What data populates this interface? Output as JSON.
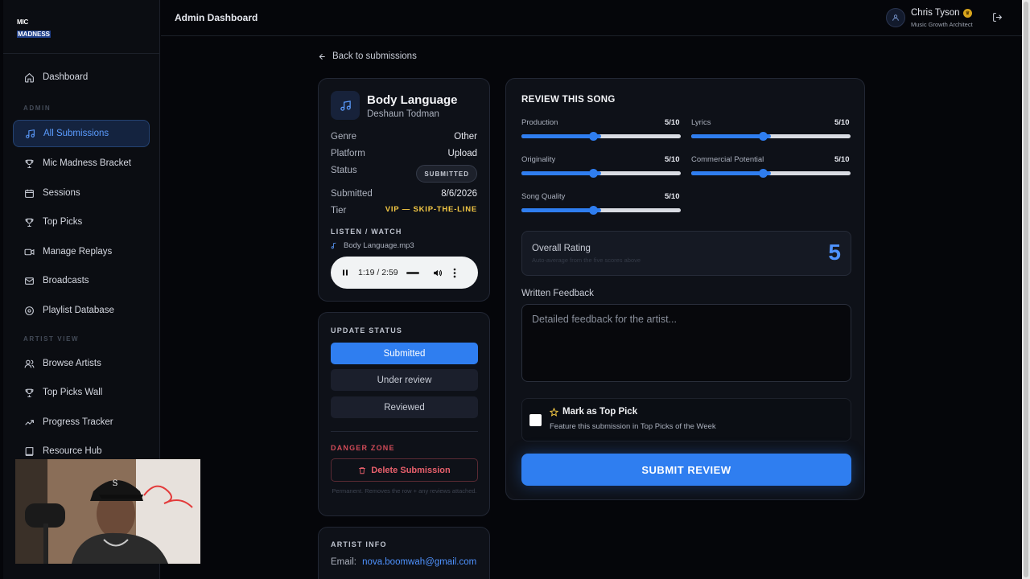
{
  "app": {
    "logo_line1": "MIC",
    "logo_line2": "MADNESS",
    "header_title": "Admin Dashboard"
  },
  "user": {
    "name": "Chris Tyson",
    "role": "Music Growth Architect"
  },
  "sidebar": {
    "items": [
      {
        "label": "Dashboard",
        "icon": "home-icon"
      },
      {
        "label": "All Submissions",
        "icon": "music-note-icon",
        "active": true
      },
      {
        "label": "Mic Madness Bracket",
        "icon": "trophy-icon"
      },
      {
        "label": "Sessions",
        "icon": "calendar-icon"
      },
      {
        "label": "Top Picks",
        "icon": "trophy-icon"
      },
      {
        "label": "Manage Replays",
        "icon": "video-icon"
      },
      {
        "label": "Broadcasts",
        "icon": "mail-icon"
      },
      {
        "label": "Playlist Database",
        "icon": "disc-icon"
      },
      {
        "label": "Browse Artists",
        "icon": "users-icon"
      },
      {
        "label": "Top Picks Wall",
        "icon": "trophy-icon"
      },
      {
        "label": "Progress Tracker",
        "icon": "trending-up-icon"
      },
      {
        "label": "Resource Hub",
        "icon": "book-icon"
      }
    ],
    "section_admin": "ADMIN",
    "section_artist": "ARTIST VIEW"
  },
  "back_link": "Back to submissions",
  "song": {
    "title": "Body Language",
    "artist": "Deshaun Todman",
    "genre_label": "Genre",
    "genre": "Other",
    "platform_label": "Platform",
    "platform": "Upload",
    "status_label": "Status",
    "status": "SUBMITTED",
    "submitted_label": "Submitted",
    "submitted": "8/6/2026",
    "tier_label": "Tier",
    "tier": "VIP — SKIP-THE-LINE",
    "listen_label": "LISTEN / WATCH",
    "file_name": "Body Language.mp3",
    "player_time": "1:19 / 2:59",
    "player_progress": 0.44
  },
  "update_status": {
    "label": "UPDATE STATUS",
    "options": [
      "Submitted",
      "Under review",
      "Reviewed"
    ]
  },
  "danger": {
    "label": "DANGER ZONE",
    "button": "Delete Submission",
    "note": "Permanent. Removes the row + any reviews attached."
  },
  "artist_info": {
    "label": "ARTIST INFO",
    "email_label": "Email:",
    "email": "nova.boomwah@gmail.com"
  },
  "review": {
    "title": "REVIEW THIS SONG",
    "sliders": [
      {
        "label": "Production",
        "value": "5/10",
        "score": 5
      },
      {
        "label": "Lyrics",
        "value": "5/10",
        "score": 5
      },
      {
        "label": "Originality",
        "value": "5/10",
        "score": 5
      },
      {
        "label": "Commercial Potential",
        "value": "5/10",
        "score": 5
      },
      {
        "label": "Song Quality",
        "value": "5/10",
        "score": 5
      }
    ],
    "overall_label": "Overall Rating",
    "overall_sub": "Auto-average from the five scores above",
    "overall_value": "5",
    "feedback_label": "Written Feedback",
    "feedback_placeholder": "Detailed feedback for the artist...",
    "top_pick_title": "Mark as Top Pick",
    "top_pick_desc": "Feature this submission in Top Picks of the Week",
    "submit": "SUBMIT REVIEW"
  },
  "colors": {
    "accent": "#2f7ef0",
    "danger": "#e8606c",
    "tier": "#f2c744"
  }
}
